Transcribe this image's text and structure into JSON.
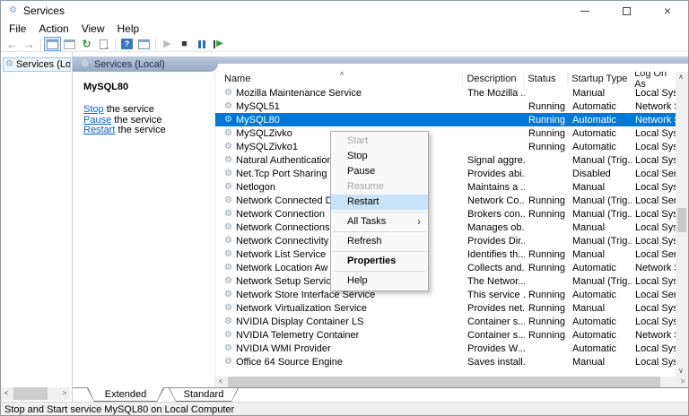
{
  "window": {
    "title": "Services"
  },
  "menubar": {
    "items": [
      {
        "label": "File"
      },
      {
        "label": "Action"
      },
      {
        "label": "View"
      },
      {
        "label": "Help"
      }
    ]
  },
  "toolbar": {
    "buttons": [
      "back",
      "forward",
      "show-hide-console-tree",
      "properties",
      "refresh",
      "export-list",
      "help",
      "show-hide-action-pane",
      "start-service",
      "stop-service",
      "pause-service",
      "restart-service"
    ]
  },
  "tree": {
    "root_label": "Services (Local)"
  },
  "taskpad": {
    "header": "Services (Local)",
    "selected_service": "MySQL80",
    "links": [
      {
        "action": "Stop",
        "suffix": " the service"
      },
      {
        "action": "Pause",
        "suffix": " the service"
      },
      {
        "action": "Restart",
        "suffix": " the service"
      }
    ]
  },
  "services": {
    "columns": [
      "Name",
      "Description",
      "Status",
      "Startup Type",
      "Log On As"
    ],
    "rows": [
      {
        "name": "Mozilla Maintenance Service",
        "description": "The Mozilla ...",
        "status": "",
        "startup_type": "Manual",
        "log_on_as": "Local Syst",
        "selected": false
      },
      {
        "name": "MySQL51",
        "description": "",
        "status": "Running",
        "startup_type": "Automatic",
        "log_on_as": "Network S",
        "selected": false
      },
      {
        "name": "MySQL80",
        "description": "",
        "status": "Running",
        "startup_type": "Automatic",
        "log_on_as": "Network S",
        "selected": true
      },
      {
        "name": "MySQLZivko",
        "description": "",
        "status": "Running",
        "startup_type": "Automatic",
        "log_on_as": "Local Syst",
        "selected": false
      },
      {
        "name": "MySQLZivko1",
        "description": "",
        "status": "Running",
        "startup_type": "Automatic",
        "log_on_as": "Local Syst",
        "selected": false
      },
      {
        "name": "Natural Authentication",
        "description": "Signal aggre...",
        "status": "",
        "startup_type": "Manual (Trig...",
        "log_on_as": "Local Syst",
        "selected": false
      },
      {
        "name": "Net.Tcp Port Sharing S",
        "description": "Provides abi...",
        "status": "",
        "startup_type": "Disabled",
        "log_on_as": "Local Serv",
        "selected": false
      },
      {
        "name": "Netlogon",
        "description": "Maintains a ...",
        "status": "",
        "startup_type": "Manual",
        "log_on_as": "Local Syst",
        "selected": false
      },
      {
        "name": "Network Connected D",
        "description": "Network Co...",
        "status": "Running",
        "startup_type": "Manual (Trig...",
        "log_on_as": "Local Serv",
        "selected": false
      },
      {
        "name": "Network Connection",
        "description": "Brokers con...",
        "status": "Running",
        "startup_type": "Manual (Trig...",
        "log_on_as": "Local Syst",
        "selected": false
      },
      {
        "name": "Network Connections",
        "description": "Manages ob...",
        "status": "",
        "startup_type": "Manual",
        "log_on_as": "Local Syst",
        "selected": false
      },
      {
        "name": "Network Connectivity",
        "description": "Provides Dir...",
        "status": "",
        "startup_type": "Manual (Trig...",
        "log_on_as": "Local Syst",
        "selected": false
      },
      {
        "name": "Network List Service",
        "description": "Identifies th...",
        "status": "Running",
        "startup_type": "Manual",
        "log_on_as": "Local Serv",
        "selected": false
      },
      {
        "name": "Network Location Aw",
        "description": "Collects and...",
        "status": "Running",
        "startup_type": "Automatic",
        "log_on_as": "Network S",
        "selected": false
      },
      {
        "name": "Network Setup Servic",
        "description": "The Networ...",
        "status": "",
        "startup_type": "Manual (Trig...",
        "log_on_as": "Local Syst",
        "selected": false
      },
      {
        "name": "Network Store Interface Service",
        "description": "This service ...",
        "status": "Running",
        "startup_type": "Automatic",
        "log_on_as": "Local Serv",
        "selected": false
      },
      {
        "name": "Network Virtualization Service",
        "description": "Provides net...",
        "status": "Running",
        "startup_type": "Manual",
        "log_on_as": "Local Syst",
        "selected": false
      },
      {
        "name": "NVIDIA Display Container LS",
        "description": "Container s...",
        "status": "Running",
        "startup_type": "Automatic",
        "log_on_as": "Local Syst",
        "selected": false
      },
      {
        "name": "NVIDIA Telemetry Container",
        "description": "Container s...",
        "status": "Running",
        "startup_type": "Automatic",
        "log_on_as": "Network S",
        "selected": false
      },
      {
        "name": "NVIDIA WMI Provider",
        "description": "Provides W...",
        "status": "",
        "startup_type": "Automatic",
        "log_on_as": "Local Syst",
        "selected": false
      },
      {
        "name": "Office 64 Source Engine",
        "description": "Saves install...",
        "status": "",
        "startup_type": "Manual",
        "log_on_as": "Local Syst",
        "selected": false
      }
    ]
  },
  "context_menu": {
    "items": [
      {
        "label": "Start",
        "disabled": true
      },
      {
        "label": "Stop"
      },
      {
        "label": "Pause"
      },
      {
        "label": "Resume",
        "disabled": true
      },
      {
        "label": "Restart",
        "highlighted": true
      },
      {
        "type": "separator"
      },
      {
        "label": "All Tasks",
        "submenu": true
      },
      {
        "type": "separator"
      },
      {
        "label": "Refresh"
      },
      {
        "type": "separator"
      },
      {
        "label": "Properties",
        "bold": true
      },
      {
        "type": "separator"
      },
      {
        "label": "Help"
      }
    ]
  },
  "tabs": {
    "items": [
      {
        "label": "Extended",
        "active": true
      },
      {
        "label": "Standard",
        "active": false
      }
    ]
  },
  "statusbar": {
    "text": "Stop and Start service MySQL80 on Local Computer"
  },
  "colors": {
    "selection": "#0078d7",
    "menu_highlight": "#c9e4f8",
    "link": "#0a63c9",
    "taskpad_header_top": "#bdc9da",
    "taskpad_header_bottom": "#93a9c4"
  }
}
